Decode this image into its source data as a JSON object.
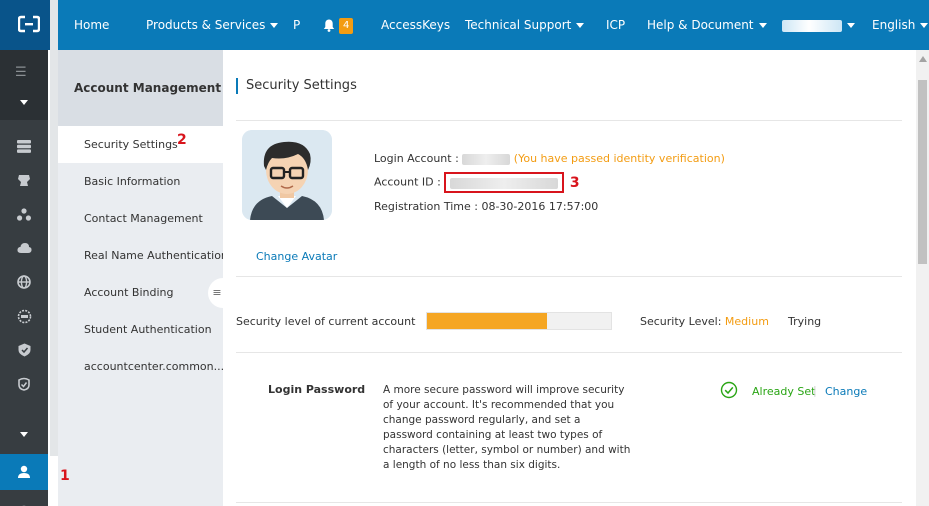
{
  "nav": {
    "home": "Home",
    "products": "Products & Services",
    "p": "P",
    "notifications_count": "4",
    "accesskeys": "AccessKeys",
    "support": "Technical Support",
    "icp": "ICP",
    "help": "Help & Document",
    "language": "English"
  },
  "sidebar": {
    "heading": "Account Management",
    "items": [
      {
        "label": "Security Settings"
      },
      {
        "label": "Basic Information"
      },
      {
        "label": "Contact Management"
      },
      {
        "label": "Real Name Authentication"
      },
      {
        "label": "Account Binding"
      },
      {
        "label": "Student Authentication"
      },
      {
        "label": "accountcenter.common...."
      }
    ]
  },
  "annotations": {
    "m1": "1",
    "m2": "2",
    "m3": "3"
  },
  "main": {
    "title": "Security Settings",
    "login_account_label": "Login Account :",
    "verified_text": "(You have passed identity verification)",
    "account_id_label": "Account ID :",
    "registration_label": "Registration Time :",
    "registration_value": "08-30-2016 17:57:00",
    "change_avatar": "Change Avatar",
    "security_level_label": "Security level of current account",
    "security_progress_fraction": 0.65,
    "security_level_prefix": "Security Level:",
    "security_level_value": "Medium",
    "trying": "Trying",
    "login_password_title": "Login Password",
    "login_password_desc": "A more secure password will improve security of your account. It's recommended that you change password regularly, and set a password containing at least two types of characters (letter, symbol or number) and with a length of no less than six digits.",
    "already_set": "Already Set",
    "separator": "|",
    "change": "Change"
  },
  "colors": {
    "nav_bg": "#0a7ab8",
    "rail_bg": "#373d41",
    "accent_orange": "#f39c12",
    "success_green": "#2aa515",
    "marker_red": "#d8141c"
  }
}
